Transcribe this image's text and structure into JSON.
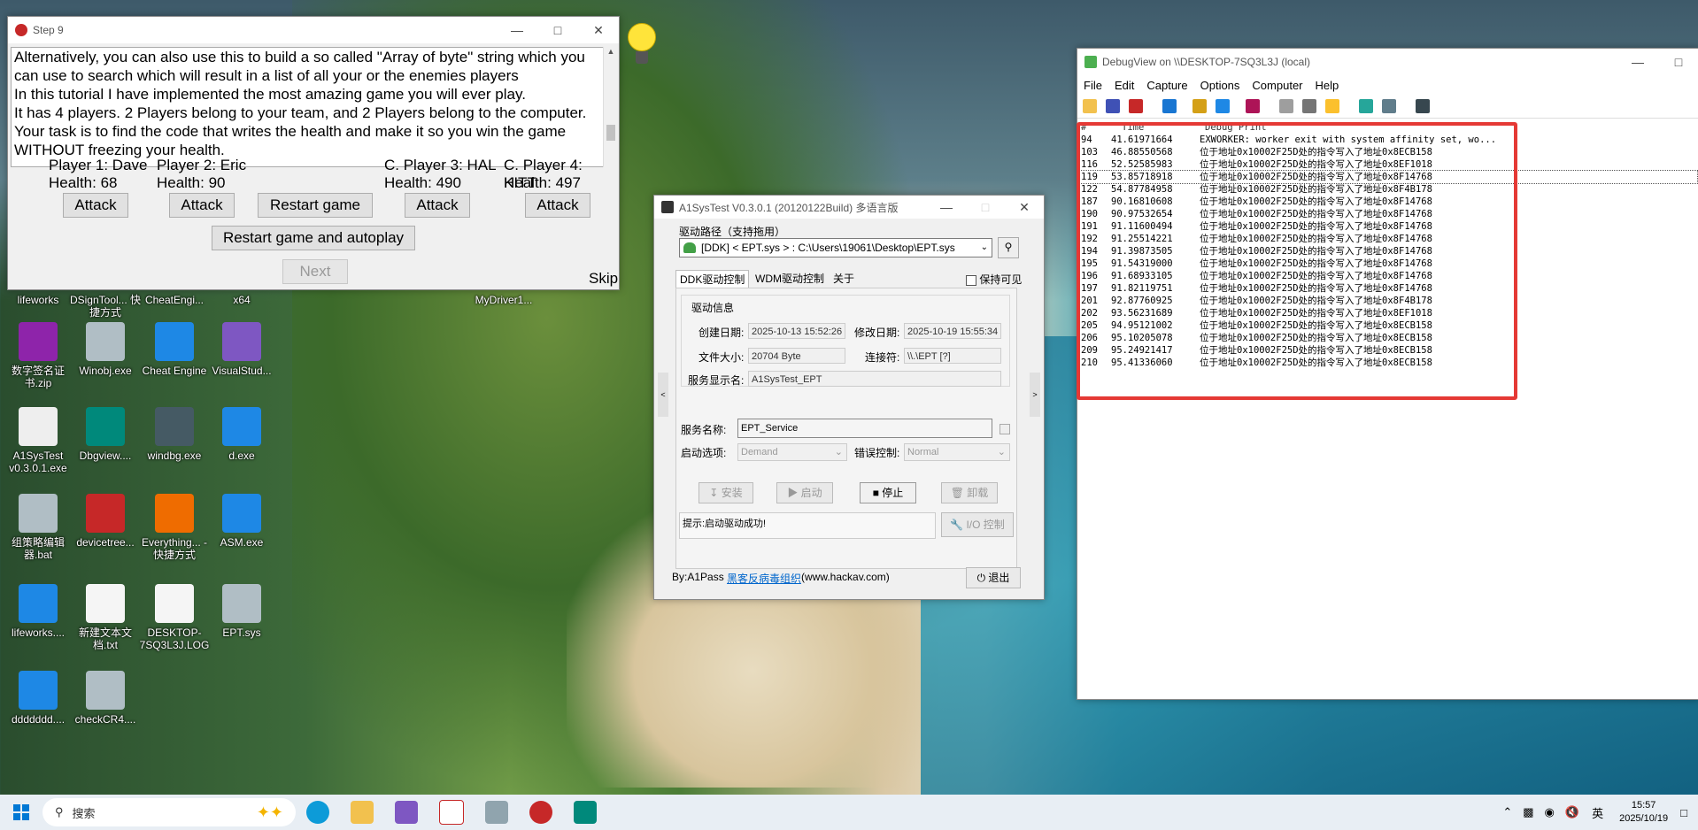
{
  "colors": {
    "highlight": "#e53935",
    "accent": "#0078d4",
    "link": "#0066cc"
  },
  "desktop": {
    "icons": [
      {
        "label": "lifeworks",
        "icon": "folder-icon"
      },
      {
        "label": "DSignTool... 快捷方式",
        "icon": "app-icon"
      },
      {
        "label": "CheatEngi...",
        "icon": "app-icon"
      },
      {
        "label": "x64",
        "icon": "folder-icon"
      },
      {
        "label": "MyDriver1...",
        "icon": "file-icon"
      },
      {
        "label": "数字签名证书.zip",
        "icon": "zip-icon"
      },
      {
        "label": "Winobj.exe",
        "icon": "gear-icon"
      },
      {
        "label": "Cheat Engine",
        "icon": "shield-icon"
      },
      {
        "label": "VisualStud...",
        "icon": "vs-icon"
      },
      {
        "label": "A1SysTest v0.3.0.1.exe",
        "icon": "a1-icon"
      },
      {
        "label": "Dbgview....",
        "icon": "bug-icon"
      },
      {
        "label": "windbg.exe",
        "icon": "windbg-icon"
      },
      {
        "label": "d.exe",
        "icon": "window-icon"
      },
      {
        "label": "组策略编辑器.bat",
        "icon": "gear-icon"
      },
      {
        "label": "devicetree...",
        "icon": "tree-icon"
      },
      {
        "label": "Everything... - 快捷方式",
        "icon": "search-icon"
      },
      {
        "label": "ASM.exe",
        "icon": "window-icon"
      },
      {
        "label": "lifeworks....",
        "icon": "window-icon"
      },
      {
        "label": "新建文本文档.txt",
        "icon": "text-icon"
      },
      {
        "label": "DESKTOP-7SQ3L3J.LOG",
        "icon": "text-icon"
      },
      {
        "label": "EPT.sys",
        "icon": "gear-icon"
      },
      {
        "label": "ddddddd....",
        "icon": "window-icon"
      },
      {
        "label": "checkCR4....",
        "icon": "gear-icon"
      }
    ]
  },
  "step9": {
    "title": "Step 9",
    "text": "Alternatively, you can also use this to build a so called \"Array of byte\" string which you can use to search which will result in a list of all your or the enemies players\nIn this tutorial I have implemented the most amazing game you will ever play.\nIt has 4 players. 2 Players belong to your team, and 2 Players belong to the computer.\nYour task is to find the code that writes the health and make it so you win the game WITHOUT freezing your health.",
    "players": [
      {
        "name": "Player 1: Dave",
        "health": "Health: 68"
      },
      {
        "name": "Player 2: Eric",
        "health": "Health: 90"
      },
      {
        "name": "C. Player 3: HAL",
        "health": "Health: 490"
      },
      {
        "name": "C. Player 4: KITT",
        "health": "Health: 497"
      }
    ],
    "attack_label": "Attack",
    "restart_label": "Restart game",
    "autoplay_label": "Restart game and autoplay",
    "next_label": "Next",
    "skip_label": "Skip"
  },
  "debugview": {
    "title": "DebugView on \\\\DESKTOP-7SQ3L3J (local)",
    "menu": [
      "File",
      "Edit",
      "Capture",
      "Options",
      "Computer",
      "Help"
    ],
    "columns": [
      "#",
      "Time",
      "Debug Print"
    ],
    "rows": [
      {
        "n": "94",
        "t": "41.61971664",
        "m": "EXWORKER: worker exit with system affinity set, wo..."
      },
      {
        "n": "103",
        "t": "46.88550568",
        "m": "位于地址0x10002F25D处的指令写入了地址0x8ECB158"
      },
      {
        "n": "116",
        "t": "52.52585983",
        "m": "位于地址0x10002F25D处的指令写入了地址0x8EF1018"
      },
      {
        "n": "119",
        "t": "53.85718918",
        "m": "位于地址0x10002F25D处的指令写入了地址0x8F14768"
      },
      {
        "n": "122",
        "t": "54.87784958",
        "m": "位于地址0x10002F25D处的指令写入了地址0x8F4B178"
      },
      {
        "n": "187",
        "t": "90.16810608",
        "m": "位于地址0x10002F25D处的指令写入了地址0x8F14768"
      },
      {
        "n": "190",
        "t": "90.97532654",
        "m": "位于地址0x10002F25D处的指令写入了地址0x8F14768"
      },
      {
        "n": "191",
        "t": "91.11600494",
        "m": "位于地址0x10002F25D处的指令写入了地址0x8F14768"
      },
      {
        "n": "192",
        "t": "91.25514221",
        "m": "位于地址0x10002F25D处的指令写入了地址0x8F14768"
      },
      {
        "n": "194",
        "t": "91.39873505",
        "m": "位于地址0x10002F25D处的指令写入了地址0x8F14768"
      },
      {
        "n": "195",
        "t": "91.54319000",
        "m": "位于地址0x10002F25D处的指令写入了地址0x8F14768"
      },
      {
        "n": "196",
        "t": "91.68933105",
        "m": "位于地址0x10002F25D处的指令写入了地址0x8F14768"
      },
      {
        "n": "197",
        "t": "91.82119751",
        "m": "位于地址0x10002F25D处的指令写入了地址0x8F14768"
      },
      {
        "n": "201",
        "t": "92.87760925",
        "m": "位于地址0x10002F25D处的指令写入了地址0x8F4B178"
      },
      {
        "n": "202",
        "t": "93.56231689",
        "m": "位于地址0x10002F25D处的指令写入了地址0x8EF1018"
      },
      {
        "n": "205",
        "t": "94.95121002",
        "m": "位于地址0x10002F25D处的指令写入了地址0x8ECB158"
      },
      {
        "n": "206",
        "t": "95.10205078",
        "m": "位于地址0x10002F25D处的指令写入了地址0x8ECB158"
      },
      {
        "n": "209",
        "t": "95.24921417",
        "m": "位于地址0x10002F25D处的指令写入了地址0x8ECB158"
      },
      {
        "n": "210",
        "t": "95.41336060",
        "m": "位于地址0x10002F25D处的指令写入了地址0x8ECB158"
      }
    ]
  },
  "a1systest": {
    "title": "A1SysTest V0.3.0.1  (20120122Build) 多语言版",
    "path_label": "驱动路径（支持拖用）",
    "path_value": "[DDK] < EPT.sys > :  C:\\Users\\19061\\Desktop\\EPT.sys",
    "tabs": [
      "DDK驱动控制",
      "WDM驱动控制",
      "关于"
    ],
    "keep_visible": "保持可见",
    "group_label": "驱动信息",
    "create_date_label": "创建日期:",
    "create_date": "2025-10-13 15:52:26",
    "modify_date_label": "修改日期:",
    "modify_date": "2025-10-19 15:55:34",
    "file_size_label": "文件大小:",
    "file_size": "20704 Byte",
    "link_label": "连接符:",
    "link_value": "\\\\.\\EPT  [?]",
    "service_display_label": "服务显示名:",
    "service_display": "A1SysTest_EPT",
    "service_name_label": "服务名称:",
    "service_name": "EPT_Service",
    "start_label": "启动选项:",
    "start_value": "Demand",
    "error_label": "错误控制:",
    "error_value": "Normal",
    "install": "安装",
    "start": "启动",
    "stop": "停止",
    "uninstall": "卸载",
    "io": "I/O 控制",
    "hint": "提示:启动驱动成功!",
    "by": "By:A1Pass",
    "org": "黑客反病毒组织",
    "site": "(www.hackav.com)",
    "exit": "退出"
  },
  "taskbar": {
    "search_placeholder": "搜索",
    "ime": "英",
    "time": "15:57",
    "date": "2025/10/19"
  }
}
